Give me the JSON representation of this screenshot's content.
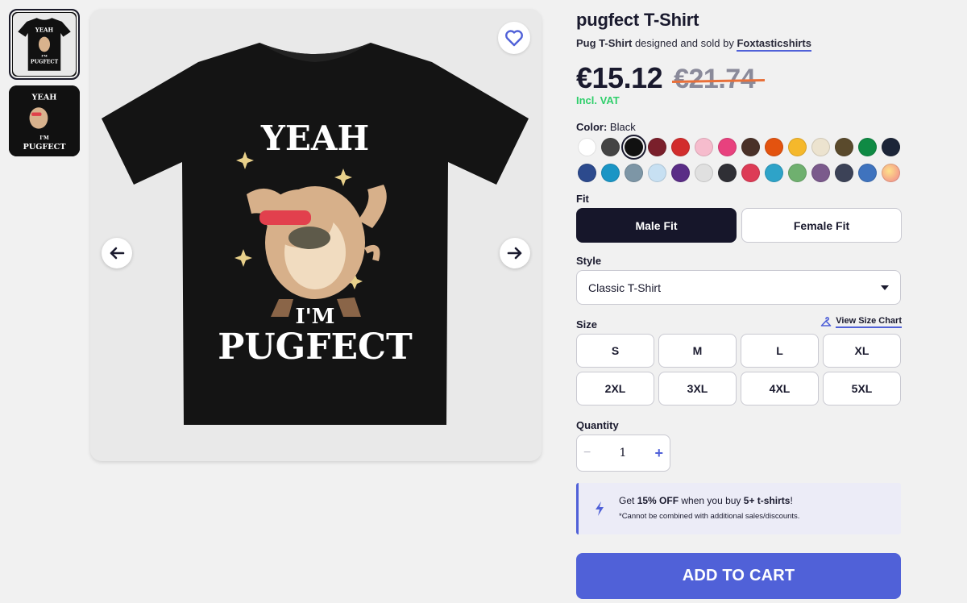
{
  "product": {
    "title": "pugfect T-Shirt",
    "type_label": "Pug T-Shirt",
    "byline_mid": " designed and sold by ",
    "artist": "Foxtasticshirts",
    "price_now": "€15.12",
    "price_was": "€21.74",
    "vat": "Incl. VAT"
  },
  "artwork": {
    "line1": "YEAH",
    "line2": "I'M",
    "line3": "PUGFECT"
  },
  "color": {
    "label": "Color:",
    "selected": "Black",
    "swatches_row1": [
      "#ffffff",
      "#444444",
      "#111111",
      "#7a1f2b",
      "#d22d2d",
      "#f6bccd",
      "#e8417e",
      "#4a3128",
      "#e3530f",
      "#f5b82b",
      "#ece3cf",
      "#5a4a2c",
      "#0f8a44",
      "#1c2538"
    ],
    "swatches_row2": [
      "#2c4a8d",
      "#1a95c5",
      "#7d96a6",
      "#c7e0f2",
      "#5a2d86",
      "#e0e0e0",
      "#2f2f35",
      "#dd3b56",
      "#2ea3c8",
      "#6fb06f",
      "#7b5a8c",
      "#3c4257",
      "#3f73be",
      "#f4a98a"
    ]
  },
  "fit": {
    "label": "Fit",
    "options": [
      "Male Fit",
      "Female Fit"
    ],
    "selected": "Male Fit"
  },
  "style": {
    "label": "Style",
    "value": "Classic T-Shirt"
  },
  "size": {
    "label": "Size",
    "chart_link": "View Size Chart",
    "options": [
      "S",
      "M",
      "L",
      "XL",
      "2XL",
      "3XL",
      "4XL",
      "5XL"
    ]
  },
  "quantity": {
    "label": "Quantity",
    "minus": "−",
    "value": "1",
    "plus": "+"
  },
  "promo": {
    "pre": "Get ",
    "discount": "15% OFF",
    "mid": " when you buy ",
    "qty": "5+ t-shirts",
    "post": "!",
    "note": "*Cannot be combined with additional sales/discounts."
  },
  "cart": {
    "label": "ADD TO CART"
  },
  "colors": {
    "accent": "#5061d8",
    "vat_green": "#2fcf6b",
    "strike": "#e8703a",
    "dark": "#16162a"
  }
}
